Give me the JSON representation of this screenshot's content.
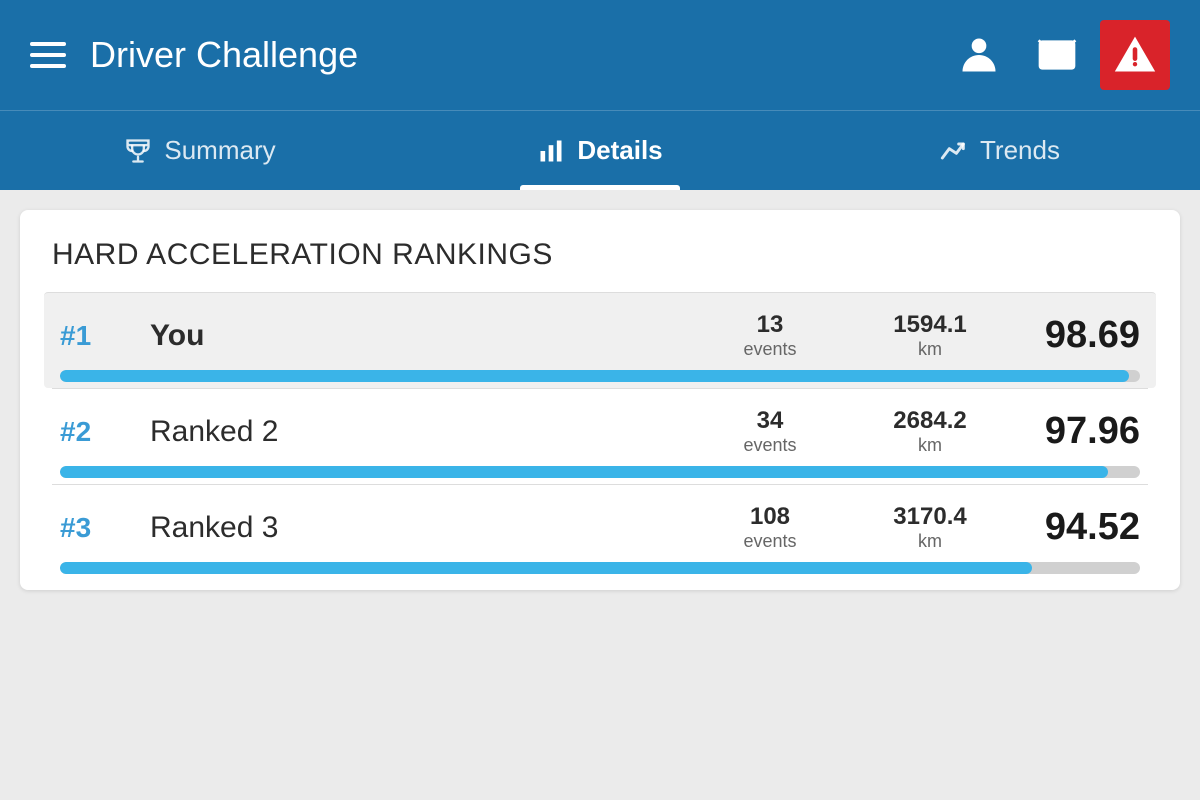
{
  "header": {
    "menu_label": "Menu",
    "title": "Driver Challenge",
    "icons": {
      "profile": "profile-icon",
      "message": "message-icon",
      "alert": "alert-icon"
    }
  },
  "nav": {
    "tabs": [
      {
        "id": "summary",
        "label": "Summary",
        "icon": "trophy-icon",
        "active": false
      },
      {
        "id": "details",
        "label": "Details",
        "icon": "bar-chart-icon",
        "active": true
      },
      {
        "id": "trends",
        "label": "Trends",
        "icon": "trend-icon",
        "active": false
      }
    ]
  },
  "main": {
    "card_title": "HARD ACCELERATION RANKINGS",
    "rankings": [
      {
        "rank": "#1",
        "name": "You",
        "events": "13",
        "events_label": "events",
        "km": "1594.1",
        "km_label": "km",
        "score": "98.69",
        "progress": 99,
        "highlighted": true
      },
      {
        "rank": "#2",
        "name": "Ranked 2",
        "events": "34",
        "events_label": "events",
        "km": "2684.2",
        "km_label": "km",
        "score": "97.96",
        "progress": 97,
        "highlighted": false
      },
      {
        "rank": "#3",
        "name": "Ranked 3",
        "events": "108",
        "events_label": "events",
        "km": "3170.4",
        "km_label": "km",
        "score": "94.52",
        "progress": 90,
        "highlighted": false
      }
    ]
  }
}
